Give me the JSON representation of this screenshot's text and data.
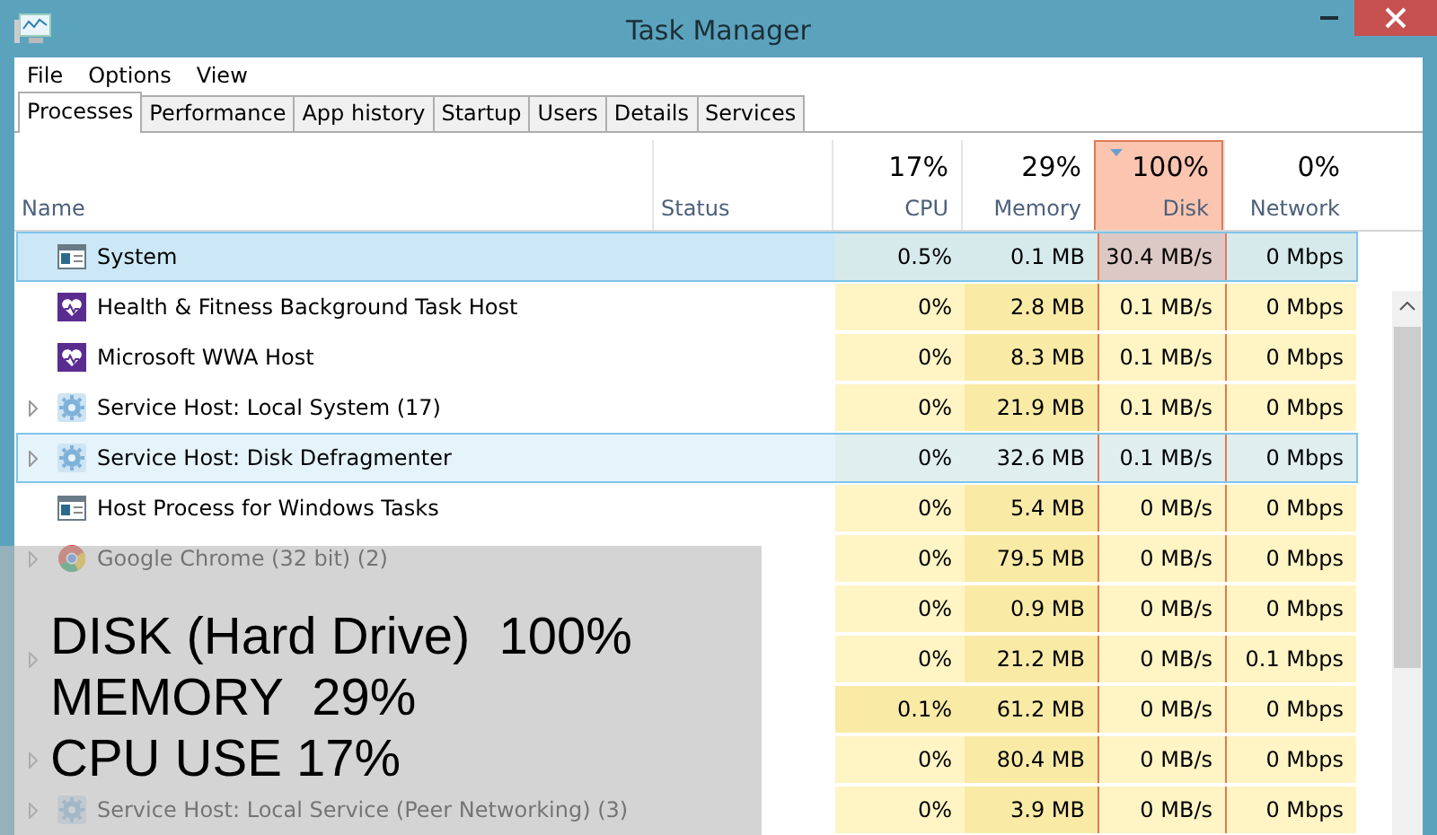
{
  "window": {
    "title": "Task Manager"
  },
  "menu": [
    "File",
    "Options",
    "View"
  ],
  "tabs": [
    {
      "label": "Processes",
      "selected": true
    },
    {
      "label": "Performance",
      "selected": false
    },
    {
      "label": "App history",
      "selected": false
    },
    {
      "label": "Startup",
      "selected": false
    },
    {
      "label": "Users",
      "selected": false
    },
    {
      "label": "Details",
      "selected": false
    },
    {
      "label": "Services",
      "selected": false
    }
  ],
  "columns": [
    {
      "label": "Name",
      "kind": "text"
    },
    {
      "label": "Status",
      "kind": "text"
    },
    {
      "label": "CPU",
      "total": "17%",
      "kind": "metric",
      "hot": false,
      "sorted": false
    },
    {
      "label": "Memory",
      "total": "29%",
      "kind": "metric",
      "hot": true,
      "sorted": false
    },
    {
      "label": "Disk",
      "total": "100%",
      "kind": "metric",
      "hot": false,
      "sorted": true
    },
    {
      "label": "Network",
      "total": "0%",
      "kind": "metric",
      "hot": false,
      "sorted": false
    }
  ],
  "rows": [
    {
      "name": "System",
      "kind": "window",
      "expandable": false,
      "selected": true,
      "hovered": false,
      "cells": [
        "0.5%",
        "0.1 MB",
        "30.4 MB/s",
        "0 Mbps"
      ]
    },
    {
      "name": "Health & Fitness Background Task Host",
      "kind": "heart",
      "expandable": false,
      "selected": false,
      "hovered": false,
      "cells": [
        "0%",
        "2.8 MB",
        "0.1 MB/s",
        "0 Mbps"
      ]
    },
    {
      "name": "Microsoft WWA Host",
      "kind": "heart",
      "expandable": false,
      "selected": false,
      "hovered": false,
      "cells": [
        "0%",
        "8.3 MB",
        "0.1 MB/s",
        "0 Mbps"
      ]
    },
    {
      "name": "Service Host: Local System (17)",
      "kind": "gear",
      "expandable": true,
      "selected": false,
      "hovered": false,
      "cells": [
        "0%",
        "21.9 MB",
        "0.1 MB/s",
        "0 Mbps"
      ]
    },
    {
      "name": "Service Host: Disk Defragmenter",
      "kind": "gear",
      "expandable": true,
      "selected": false,
      "hovered": true,
      "cells": [
        "0%",
        "32.6 MB",
        "0.1 MB/s",
        "0 Mbps"
      ]
    },
    {
      "name": "Host Process for Windows Tasks",
      "kind": "window",
      "expandable": false,
      "selected": false,
      "hovered": false,
      "cells": [
        "0%",
        "5.4 MB",
        "0 MB/s",
        "0 Mbps"
      ]
    },
    {
      "name": "Google Chrome (32 bit) (2)",
      "kind": "chrome",
      "expandable": true,
      "selected": false,
      "hovered": false,
      "cells": [
        "0%",
        "79.5 MB",
        "0 MB/s",
        "0 Mbps"
      ]
    },
    {
      "expandable": false,
      "selected": false,
      "hovered": false,
      "cells": [
        "0%",
        "0.9 MB",
        "0 MB/s",
        "0 Mbps"
      ]
    },
    {
      "expandable": true,
      "selected": false,
      "hovered": false,
      "cells": [
        "0%",
        "21.2 MB",
        "0 MB/s",
        "0.1 Mbps"
      ]
    },
    {
      "expandable": false,
      "selected": false,
      "hovered": false,
      "cells": [
        {
          "text": "0.1%",
          "hot": true
        },
        "61.2 MB",
        "0 MB/s",
        "0 Mbps"
      ]
    },
    {
      "expandable": true,
      "selected": false,
      "hovered": false,
      "cells": [
        "0%",
        "80.4 MB",
        "0 MB/s",
        "0 Mbps"
      ]
    },
    {
      "name": "Service Host: Local Service (Peer Networking) (3)",
      "kind": "gear",
      "expandable": true,
      "selected": false,
      "hovered": false,
      "cells": [
        "0%",
        "3.9 MB",
        "0 MB/s",
        "0 Mbps"
      ]
    }
  ],
  "caption": {
    "lines": [
      "DISK (Hard Drive)  100%",
      "MEMORY  29%",
      "CPU USE 17%"
    ]
  }
}
